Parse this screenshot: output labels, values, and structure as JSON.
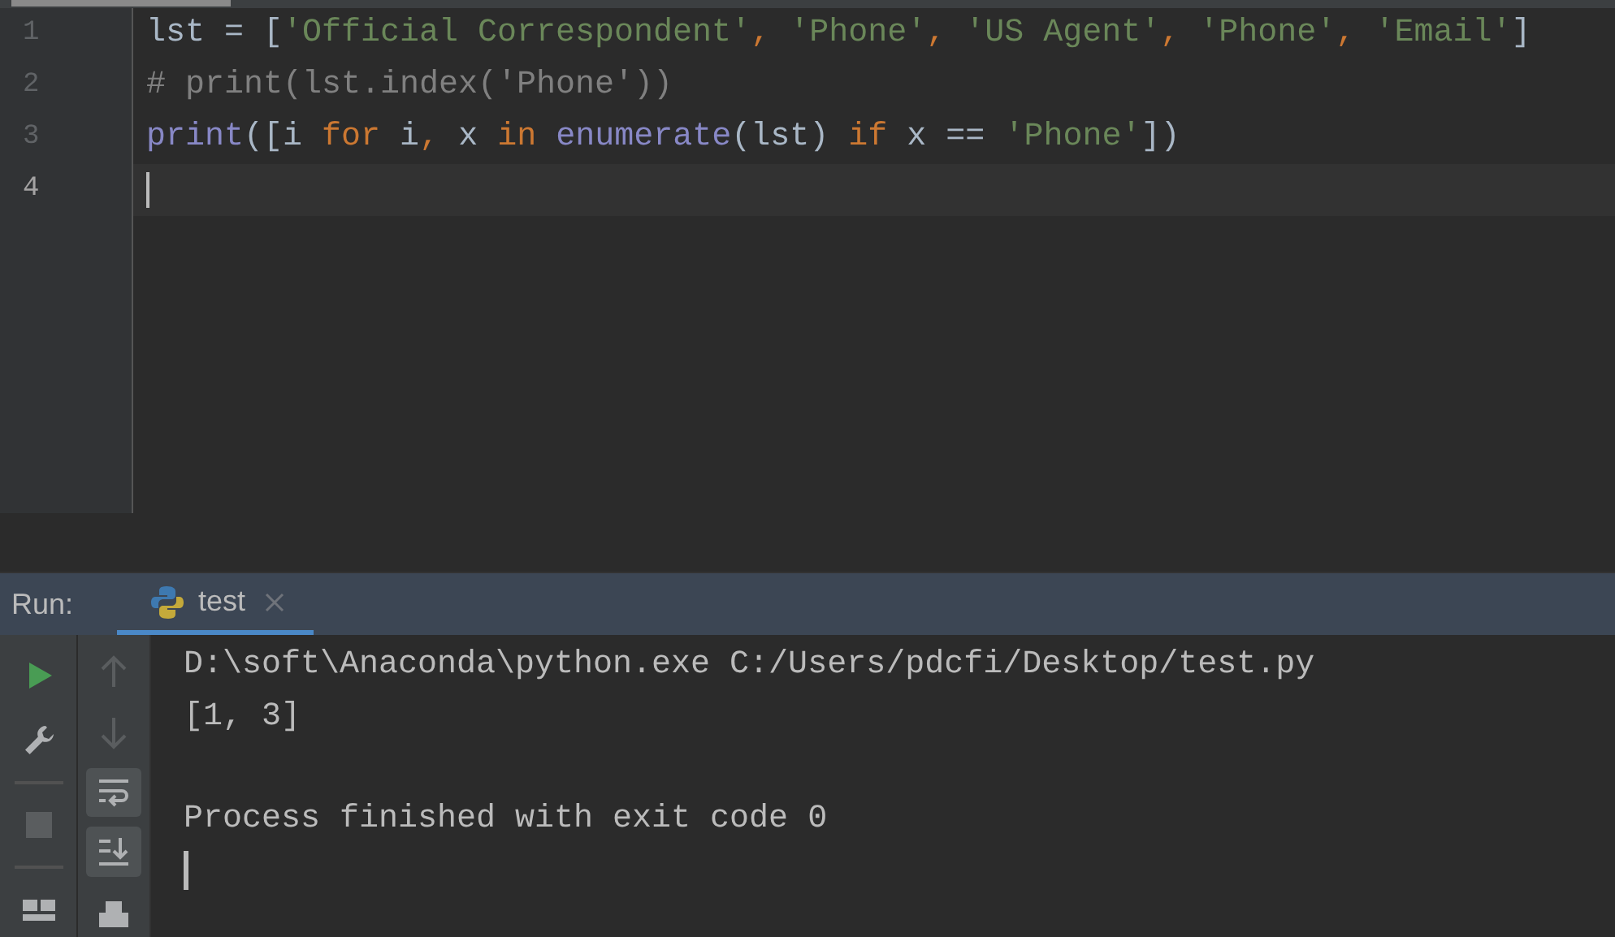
{
  "editor": {
    "lines": [
      {
        "number": "1",
        "current": false,
        "tokens": [
          {
            "kind": "plain",
            "text": "lst = ["
          },
          {
            "kind": "string",
            "text": "'Official Correspondent'"
          },
          {
            "kind": "punct",
            "text": ", "
          },
          {
            "kind": "string",
            "text": "'Phone'"
          },
          {
            "kind": "punct",
            "text": ", "
          },
          {
            "kind": "string",
            "text": "'US Agent'"
          },
          {
            "kind": "punct",
            "text": ", "
          },
          {
            "kind": "string",
            "text": "'Phone'"
          },
          {
            "kind": "punct",
            "text": ", "
          },
          {
            "kind": "string",
            "text": "'Email'"
          },
          {
            "kind": "plain",
            "text": "]"
          }
        ]
      },
      {
        "number": "2",
        "current": false,
        "tokens": [
          {
            "kind": "comment",
            "text": "# print(lst.index('Phone'))"
          }
        ]
      },
      {
        "number": "3",
        "current": false,
        "tokens": [
          {
            "kind": "builtin",
            "text": "print"
          },
          {
            "kind": "plain",
            "text": "([i "
          },
          {
            "kind": "keyword",
            "text": "for"
          },
          {
            "kind": "plain",
            "text": " i"
          },
          {
            "kind": "punct",
            "text": ", "
          },
          {
            "kind": "plain",
            "text": "x "
          },
          {
            "kind": "keyword",
            "text": "in "
          },
          {
            "kind": "builtin",
            "text": "enumerate"
          },
          {
            "kind": "plain",
            "text": "(lst) "
          },
          {
            "kind": "keyword",
            "text": "if"
          },
          {
            "kind": "plain",
            "text": " x == "
          },
          {
            "kind": "string",
            "text": "'Phone'"
          },
          {
            "kind": "plain",
            "text": "])"
          }
        ]
      },
      {
        "number": "4",
        "current": true
      }
    ]
  },
  "run": {
    "label": "Run:",
    "tabs": [
      {
        "label": "test",
        "selected": true
      }
    ],
    "toolbar_left": [
      {
        "kind": "run"
      },
      {
        "kind": "wrench"
      },
      {
        "kind": "stop"
      },
      {
        "kind": "layout"
      }
    ],
    "toolbar_right": [
      {
        "kind": "up",
        "disabled": true,
        "selected": false
      },
      {
        "kind": "down",
        "disabled": true,
        "selected": false
      },
      {
        "kind": "wrap",
        "disabled": false,
        "selected": true
      },
      {
        "kind": "scroll-end",
        "disabled": false,
        "selected": true
      },
      {
        "kind": "print",
        "disabled": false,
        "selected": false
      }
    ],
    "console": [
      {
        "text": "D:\\soft\\Anaconda\\python.exe C:/Users/pdcfi/Desktop/test.py",
        "blank_line_before": false
      },
      {
        "text": "[1, 3]",
        "blank_line_before": false
      },
      {
        "text": "Process finished with exit code 0",
        "blank_line_before": true
      }
    ]
  }
}
